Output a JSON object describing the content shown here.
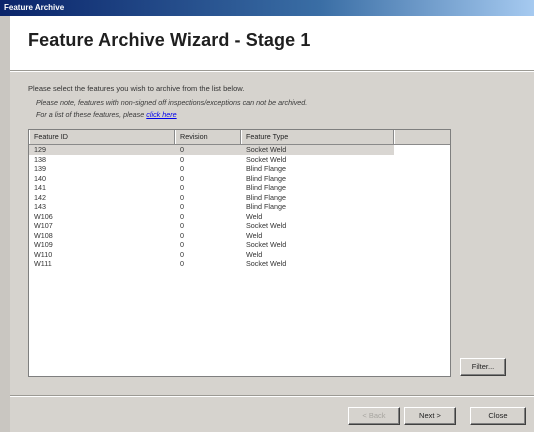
{
  "window": {
    "title": "Feature Archive"
  },
  "header": {
    "title": "Feature Archive Wizard - Stage 1"
  },
  "instructions": {
    "line1": "Please select the features you wish to archive from the list below.",
    "note": "Please note, features with non-signed off inspections/exceptions can not be archived.",
    "link_prefix": "For a list of these features, please ",
    "link_text": "click here"
  },
  "table": {
    "columns": [
      "Feature ID",
      "Revision",
      "Feature Type",
      ""
    ],
    "rows": [
      [
        "129",
        "0",
        "Socket Weld"
      ],
      [
        "138",
        "0",
        "Socket Weld"
      ],
      [
        "139",
        "0",
        "Blind Flange"
      ],
      [
        "140",
        "0",
        "Blind Flange"
      ],
      [
        "141",
        "0",
        "Blind Flange"
      ],
      [
        "142",
        "0",
        "Blind Flange"
      ],
      [
        "143",
        "0",
        "Blind Flange"
      ],
      [
        "W106",
        "0",
        "Weld"
      ],
      [
        "W107",
        "0",
        "Socket Weld"
      ],
      [
        "W108",
        "0",
        "Weld"
      ],
      [
        "W109",
        "0",
        "Socket Weld"
      ],
      [
        "W110",
        "0",
        "Weld"
      ],
      [
        "W111",
        "0",
        "Socket Weld"
      ]
    ],
    "selected_row": 0
  },
  "buttons": {
    "filter": "Filter...",
    "back": "< Back",
    "next": "Next >",
    "close": "Close"
  }
}
